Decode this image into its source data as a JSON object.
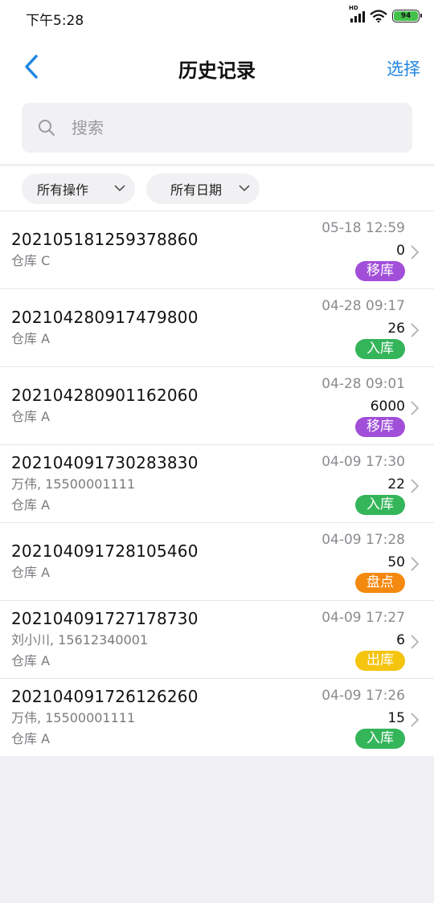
{
  "status_bar": {
    "time": "下午5:28",
    "battery": "94",
    "network": "HD"
  },
  "nav": {
    "title": "历史记录",
    "select_label": "选择"
  },
  "search": {
    "placeholder": "搜索",
    "value": ""
  },
  "filters": [
    {
      "label": "所有操作"
    },
    {
      "label": "所有日期"
    }
  ],
  "tag_colors": {
    "移库": "#a14fd9",
    "入库": "#34b55a",
    "盘点": "#f4890f",
    "出库": "#f5c40f"
  },
  "records": [
    {
      "order": "202105181259378860",
      "lines": [
        "仓库 C"
      ],
      "time": "05-18 12:59",
      "qty": "0",
      "tag": "移库"
    },
    {
      "order": "202104280917479800",
      "lines": [
        "仓库 A"
      ],
      "time": "04-28 09:17",
      "qty": "26",
      "tag": "入库"
    },
    {
      "order": "202104280901162060",
      "lines": [
        "仓库 A"
      ],
      "time": "04-28 09:01",
      "qty": "6000",
      "tag": "移库"
    },
    {
      "order": "202104091730283830",
      "lines": [
        "万伟, 15500001111",
        "仓库 A"
      ],
      "time": "04-09 17:30",
      "qty": "22",
      "tag": "入库"
    },
    {
      "order": "202104091728105460",
      "lines": [
        "仓库 A"
      ],
      "time": "04-09 17:28",
      "qty": "50",
      "tag": "盘点"
    },
    {
      "order": "202104091727178730",
      "lines": [
        "刘小川, 15612340001",
        "仓库 A"
      ],
      "time": "04-09 17:27",
      "qty": "6",
      "tag": "出库"
    },
    {
      "order": "202104091726126260",
      "lines": [
        "万伟, 15500001111",
        "仓库 A"
      ],
      "time": "04-09 17:26",
      "qty": "15",
      "tag": "入库"
    }
  ]
}
